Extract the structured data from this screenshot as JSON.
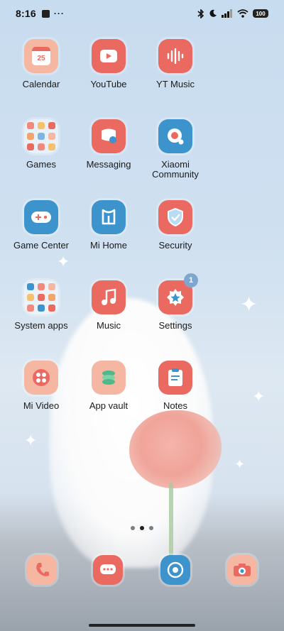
{
  "status_bar": {
    "time": "8:16",
    "more": "···",
    "battery": "100"
  },
  "apps": [
    {
      "label": "Calendar",
      "icon": "calendar-icon",
      "glyph": "25"
    },
    {
      "label": "YouTube",
      "icon": "youtube-icon"
    },
    {
      "label": "YT Music",
      "icon": "yt-music-icon"
    },
    {
      "label": "Games",
      "icon": "games-folder-icon"
    },
    {
      "label": "Messaging",
      "icon": "messaging-icon"
    },
    {
      "label": "Xiaomi Community",
      "icon": "xiaomi-community-icon"
    },
    {
      "label": "Game Center",
      "icon": "game-center-icon"
    },
    {
      "label": "Mi Home",
      "icon": "mi-home-icon"
    },
    {
      "label": "Security",
      "icon": "security-icon"
    },
    {
      "label": "System apps",
      "icon": "system-apps-folder-icon"
    },
    {
      "label": "Music",
      "icon": "music-icon"
    },
    {
      "label": "Settings",
      "icon": "settings-icon",
      "badge": "1"
    },
    {
      "label": "Mi Video",
      "icon": "mi-video-icon"
    },
    {
      "label": "App vault",
      "icon": "app-vault-icon"
    },
    {
      "label": "Notes",
      "icon": "notes-icon"
    }
  ],
  "dock": [
    {
      "icon": "phone-icon"
    },
    {
      "icon": "chat-icon"
    },
    {
      "icon": "chrome-icon"
    },
    {
      "icon": "camera-icon"
    }
  ],
  "page_indicator": {
    "pages": 3,
    "active": 2
  },
  "colors": {
    "icon_red": "#ea6a62",
    "icon_peach": "#f5b7a2",
    "icon_blue": "#3d93cc",
    "badge": "#7ea6cf"
  }
}
